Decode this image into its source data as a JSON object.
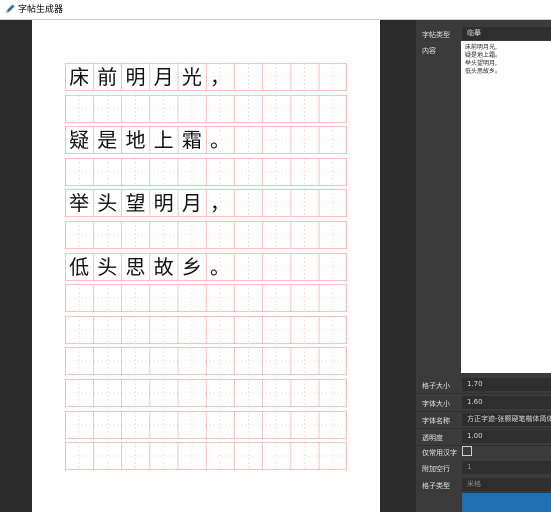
{
  "window": {
    "title": "字帖生成器"
  },
  "paper": {
    "rows": [
      {
        "chars": [
          "床",
          "前",
          "明",
          "月",
          "光",
          "，"
        ]
      },
      {
        "chars": []
      },
      {
        "chars": [
          "疑",
          "是",
          "地",
          "上",
          "霜",
          "。"
        ]
      },
      {
        "chars": []
      },
      {
        "chars": [
          "举",
          "头",
          "望",
          "明",
          "月",
          "，"
        ]
      },
      {
        "chars": []
      },
      {
        "chars": [
          "低",
          "头",
          "思",
          "故",
          "乡",
          "。"
        ]
      },
      {
        "chars": []
      },
      {
        "chars": []
      },
      {
        "chars": []
      },
      {
        "chars": []
      },
      {
        "chars": []
      },
      {
        "chars": []
      }
    ]
  },
  "panel": {
    "type_label": "字帖类型",
    "type_value": "临摹",
    "content_label": "内容",
    "content_lines": [
      "床前明月光,",
      "疑是地上霜。",
      "举头望明月,",
      "低头思故乡。"
    ],
    "cell_size_label": "格子大小",
    "cell_size_value": "1.70",
    "font_size_label": "字体大小",
    "font_size_value": "1.60",
    "font_name_label": "字体名称",
    "font_name_value": "方正字迹-张颢硬笔楷体简体",
    "opacity_label": "透明度",
    "opacity_value": "1.00",
    "common_only_label": "仅常用汉字",
    "extra_rows_label": "附加空行",
    "extra_rows_value": "1",
    "grid_type_label": "格子类型",
    "grid_type_value": "米格"
  },
  "colors": {
    "grid_line": "#f3a7a7",
    "grid_dash": "#f7caca",
    "accent": "#1f6fb2"
  }
}
